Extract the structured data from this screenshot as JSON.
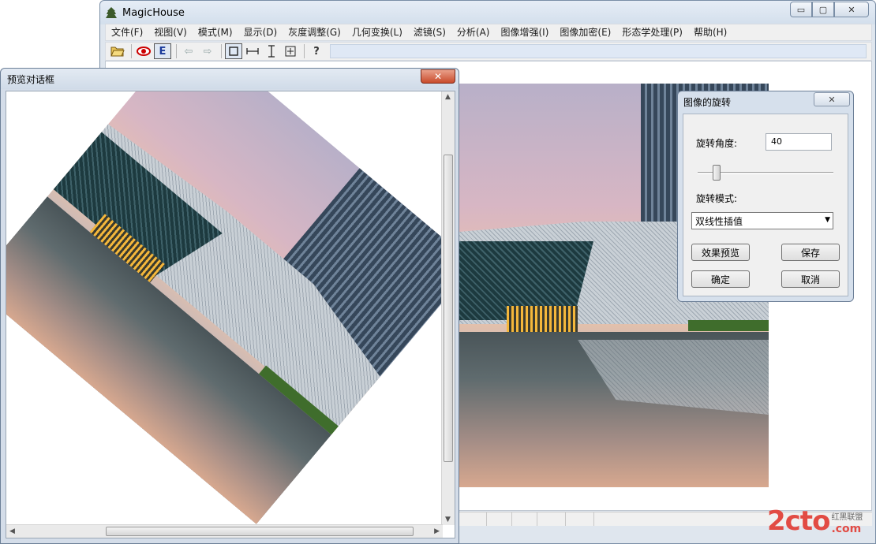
{
  "main_window": {
    "title": "MagicHouse",
    "menu": [
      "文件(F)",
      "视图(V)",
      "模式(M)",
      "显示(D)",
      "灰度调整(G)",
      "几何变换(L)",
      "滤镜(S)",
      "分析(A)",
      "图像增强(I)",
      "图像加密(E)",
      "形态学处理(P)",
      "帮助(H)"
    ],
    "toolbar": {
      "e_label": "E",
      "help_label": "?"
    },
    "caption": {
      "minimize": "▭",
      "maximize": "▢",
      "close": "✕"
    }
  },
  "preview_dialog": {
    "title": "预览对话框",
    "close": "✕",
    "rotation_degrees": 40
  },
  "rotate_dialog": {
    "title": "图像的旋转",
    "close": "✕",
    "angle_label": "旋转角度:",
    "angle_value": "40",
    "mode_label": "旋转模式:",
    "mode_value": "双线性插值",
    "preview_button": "效果预览",
    "save_button": "保存",
    "ok_button": "确定",
    "cancel_button": "取消"
  },
  "watermark": {
    "main": "2cto",
    "sub_top": "红黑联盟",
    "sub_bottom": ".com"
  },
  "colors": {
    "accent_close": "#c94b2b",
    "watermark": "#e24b43"
  },
  "icons": [
    "app-icon",
    "open-folder-icon",
    "eye-icon",
    "e-icon",
    "back-arrow-icon",
    "forward-arrow-icon",
    "select-rect-icon",
    "measure-horizontal-icon",
    "measure-vertical-icon",
    "fit-window-icon",
    "help-icon"
  ]
}
